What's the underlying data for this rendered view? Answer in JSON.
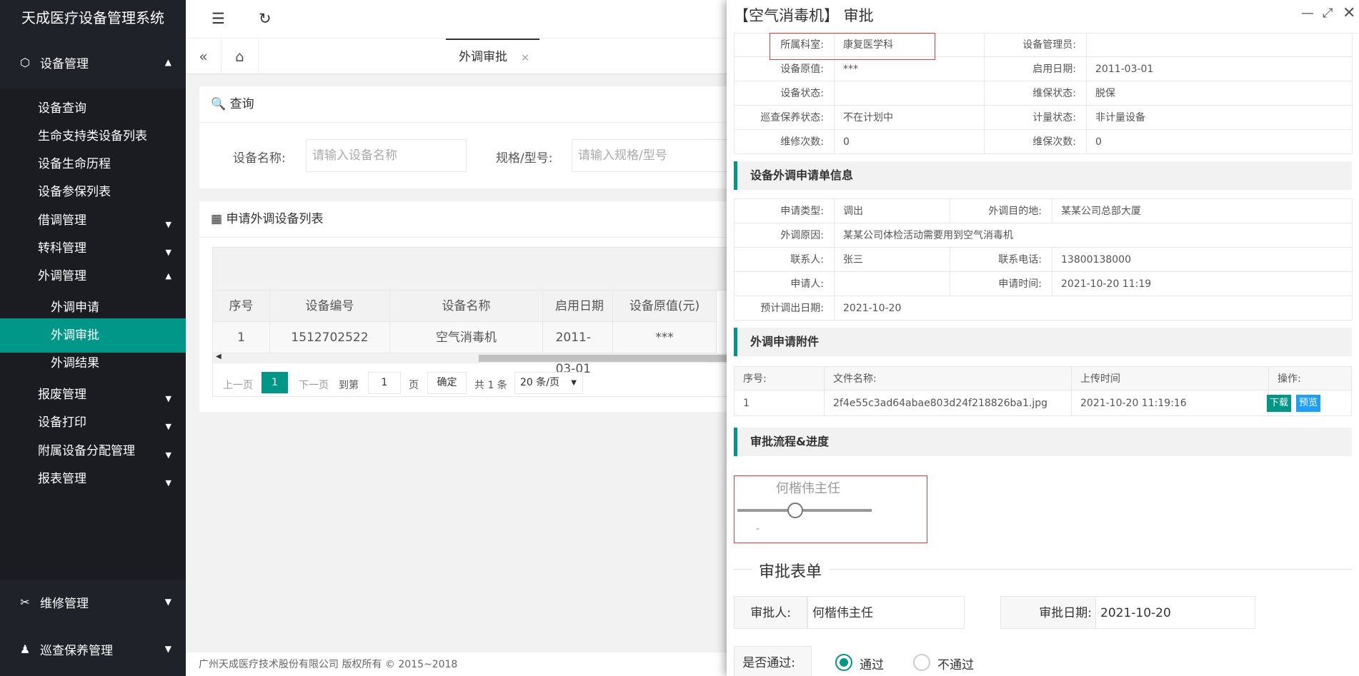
{
  "app": {
    "title": "天成医疗设备管理系统"
  },
  "sidebar": {
    "equipment": "设备管理",
    "sub": [
      {
        "label": "设备查询"
      },
      {
        "label": "生命支持类设备列表"
      },
      {
        "label": "设备生命历程"
      },
      {
        "label": "设备参保列表"
      },
      {
        "label": "借调管理"
      },
      {
        "label": "转科管理"
      },
      {
        "label": "外调管理"
      },
      {
        "label": "外调申请"
      },
      {
        "label": "外调审批"
      },
      {
        "label": "外调结果"
      },
      {
        "label": "报废管理"
      },
      {
        "label": "设备打印"
      },
      {
        "label": "附属设备分配管理"
      },
      {
        "label": "报表管理"
      }
    ],
    "repair": "维修管理",
    "inspect": "巡查保养管理"
  },
  "tabs": {
    "active": "外调审批",
    "close": "×"
  },
  "query": {
    "title": "查询",
    "name_label": "设备名称:",
    "name_placeholder": "请输入设备名称",
    "model_label": "规格/型号:",
    "model_placeholder": "请输入规格/型号"
  },
  "list": {
    "title": "申请外调设备列表",
    "headers": [
      "序号",
      "设备编号",
      "设备名称",
      "启用日期",
      "设备原值(元)"
    ],
    "row": [
      "1",
      "1512702522",
      "空气消毒机",
      "2011-03-01",
      "***"
    ],
    "pager": {
      "prev": "上一页",
      "page": "1",
      "next": "下一页",
      "goto": "到第",
      "goto_value": "1",
      "page_unit": "页",
      "confirm": "确定",
      "total": "共 1 条",
      "size": "20 条/页"
    }
  },
  "footer": "广州天成医疗技术股份有限公司 版权所有 © 2015~2018",
  "panel": {
    "title": "【空气消毒机】 审批",
    "info": [
      [
        "所属科室:",
        "康复医学科",
        "设备管理员:",
        ""
      ],
      [
        "设备原值:",
        "***",
        "启用日期:",
        "2011-03-01"
      ],
      [
        "设备状态:",
        "",
        "维保状态:",
        "脱保"
      ],
      [
        "巡查保养状态:",
        "不在计划中",
        "计量状态:",
        "非计量设备"
      ],
      [
        "维修次数:",
        "0",
        "维保次数:",
        "0"
      ]
    ],
    "apply_title": "设备外调申请单信息",
    "apply": {
      "type_k": "申请类型:",
      "type_v": "调出",
      "dest_k": "外调目的地:",
      "dest_v": "某某公司总部大厦",
      "reason_k": "外调原因:",
      "reason_v": "某某公司体检活动需要用到空气消毒机",
      "contact_k": "联系人:",
      "contact_v": "张三",
      "phone_k": "联系电话:",
      "phone_v": "13800138000",
      "applicant_k": "申请人:",
      "applicant_v": "",
      "time_k": "申请时间:",
      "time_v": "2021-10-20 11:19",
      "date_k": "预计调出日期:",
      "date_v": "2021-10-20"
    },
    "attach_title": "外调申请附件",
    "attach_headers": [
      "序号:",
      "文件名称:",
      "上传时间",
      "操作:"
    ],
    "attach_row": [
      "1",
      "2f4e55c3ad64abae803d24f218826ba1.jpg",
      "2021-10-20 11:19:16"
    ],
    "download": "下载",
    "preview": "预览",
    "flow_title": "审批流程&进度",
    "flow_person": "何楷伟主任",
    "flow_dash": "-",
    "form_title": "审批表单",
    "approver_k": "审批人:",
    "approver_v": "何楷伟主任",
    "approve_date_k": "审批日期:",
    "approve_date_v": "2021-10-20",
    "pass_k": "是否通过:",
    "pass_yes": "通过",
    "pass_no": "不通过"
  },
  "colors": {
    "accent": "#009688",
    "sidebar": "#20222a",
    "highlight": "#e83a3a",
    "preview": "#1e9fff"
  }
}
